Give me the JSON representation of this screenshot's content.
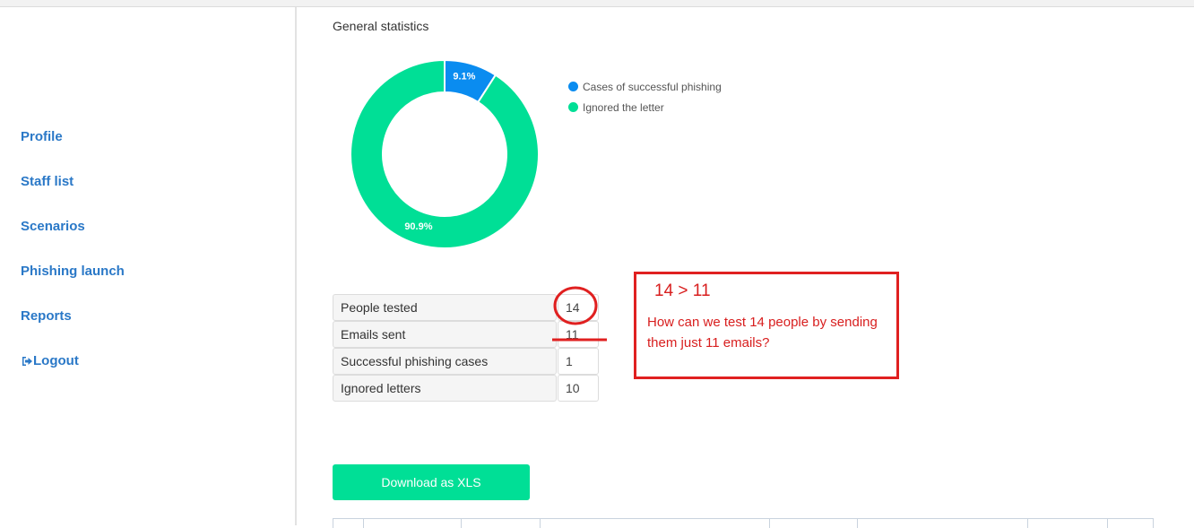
{
  "sidebar": {
    "items": [
      {
        "label": "Profile"
      },
      {
        "label": "Staff list"
      },
      {
        "label": "Scenarios"
      },
      {
        "label": "Phishing launch"
      },
      {
        "label": "Reports"
      },
      {
        "label": "Logout",
        "icon": "logout-icon"
      }
    ]
  },
  "main": {
    "title": "General statistics",
    "download_label": "Download as XLS"
  },
  "chart_data": {
    "type": "pie",
    "categories": [
      "Cases of successful phishing",
      "Ignored the letter"
    ],
    "values": [
      9.1,
      90.9
    ],
    "labels": [
      "9.1%",
      "90.9%"
    ],
    "colors": [
      "#0a8cf0",
      "#00df96"
    ],
    "legend": "right"
  },
  "stats": [
    {
      "label": "People tested",
      "value": "14"
    },
    {
      "label": "Emails sent",
      "value": "11"
    },
    {
      "label": "Successful phishing cases",
      "value": "1"
    },
    {
      "label": "Ignored letters",
      "value": "10"
    }
  ],
  "annotation": {
    "heading": "14 > 11",
    "text": "How can we test 14 people by sending them just 11 emails?",
    "color": "#d81e1e"
  }
}
